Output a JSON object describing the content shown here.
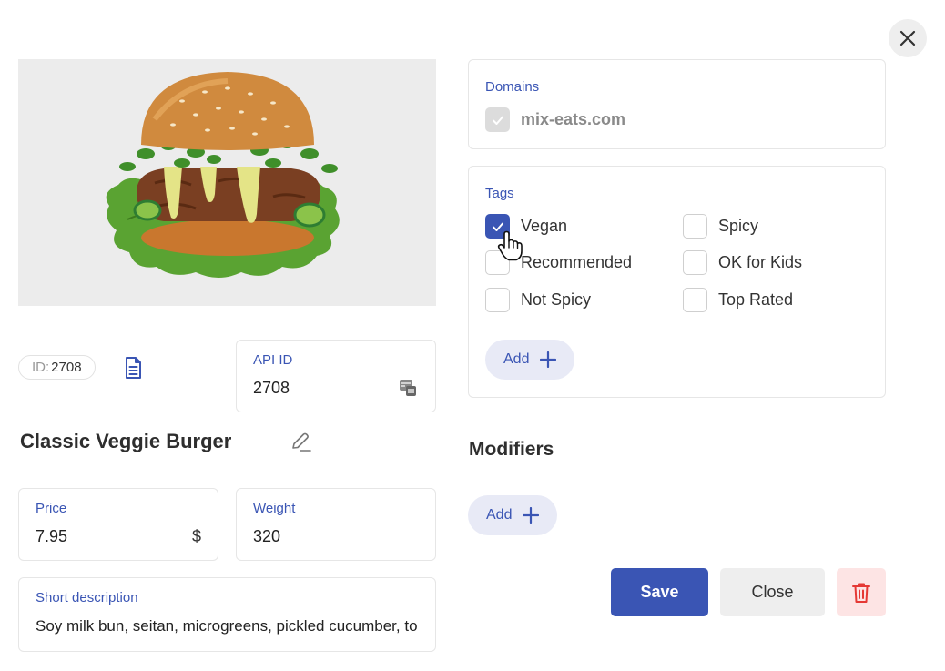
{
  "close_icon": "close-icon",
  "product": {
    "image_alt": "burger-image",
    "id_label": "ID:",
    "id_value": "2708",
    "name": "Classic Veggie Burger"
  },
  "api_id": {
    "label": "API ID",
    "value": "2708"
  },
  "price": {
    "label": "Price",
    "value": "7.95",
    "currency": "$"
  },
  "weight": {
    "label": "Weight",
    "value": "320"
  },
  "short_description": {
    "label": "Short description",
    "value": "Soy milk bun, seitan, microgreens, pickled cucumber, to"
  },
  "domains": {
    "label": "Domains",
    "items": [
      {
        "label": "mix-eats.com",
        "checked": true,
        "disabled": true
      }
    ]
  },
  "tags": {
    "label": "Tags",
    "items": [
      {
        "label": "Vegan",
        "checked": true
      },
      {
        "label": "Spicy",
        "checked": false
      },
      {
        "label": "Recommended",
        "checked": false
      },
      {
        "label": "OK for Kids",
        "checked": false
      },
      {
        "label": "Not Spicy",
        "checked": false
      },
      {
        "label": "Top Rated",
        "checked": false
      }
    ],
    "add_label": "Add"
  },
  "modifiers": {
    "heading": "Modifiers",
    "add_label": "Add"
  },
  "actions": {
    "save": "Save",
    "close": "Close",
    "delete_icon": "trash-icon"
  },
  "colors": {
    "accent": "#3a55b4",
    "accent_light": "#e8eaf6",
    "danger": "#e53935",
    "danger_light": "#fde4e4"
  }
}
